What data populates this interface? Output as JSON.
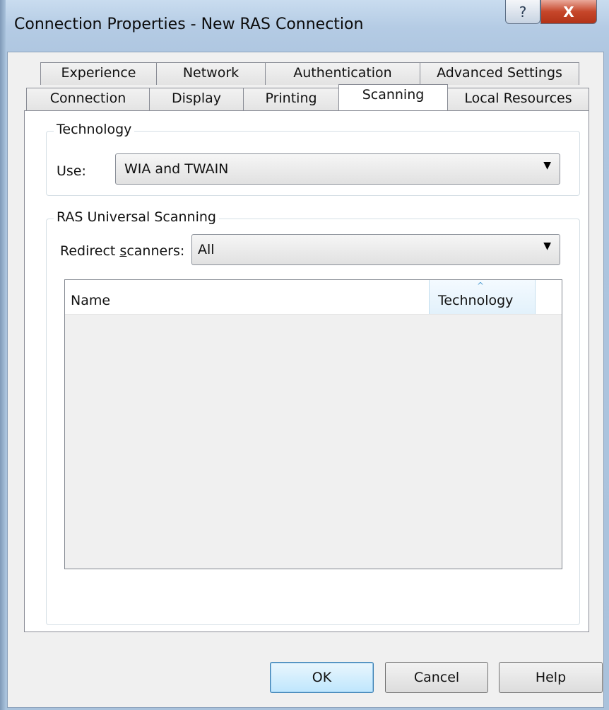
{
  "window": {
    "title": "Connection Properties - New RAS Connection",
    "help_glyph": "?",
    "close_glyph": "X"
  },
  "tabs": {
    "row_back": [
      "Experience",
      "Network",
      "Authentication",
      "Advanced Settings"
    ],
    "row_front": [
      "Connection",
      "Display",
      "Printing",
      "Scanning",
      "Local Resources"
    ],
    "active": "Scanning"
  },
  "technology_group": {
    "legend": "Technology",
    "use_label": "Use:",
    "use_value": "WIA and TWAIN"
  },
  "scanning_group": {
    "legend": "RAS Universal Scanning",
    "redirect_label": "Redirect scanners:",
    "redirect_value": "All",
    "list_columns": [
      "Name",
      "Technology"
    ],
    "sorted_column": "Technology",
    "rows": []
  },
  "buttons": {
    "ok": "OK",
    "cancel": "Cancel",
    "help": "Help"
  },
  "icons": {
    "dropdown_arrow": "▼",
    "sort_ascending": "^"
  }
}
